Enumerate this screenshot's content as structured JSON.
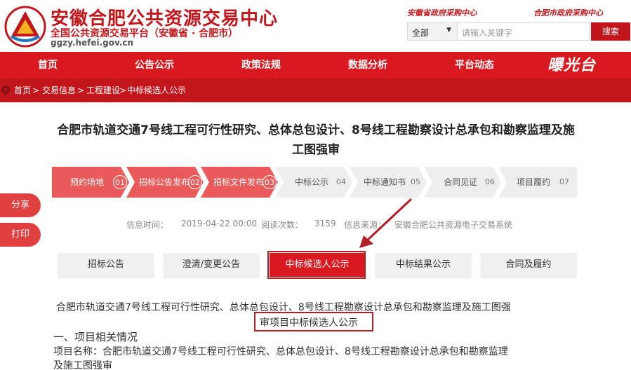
{
  "header": {
    "site_title": "安徽合肥公共资源交易中心",
    "site_subtitle": "全国公共资源交易平台（安徽省 · 合肥市）",
    "site_domain": "ggzy.hefei.gov.cn",
    "gov_link_province": "安徽省政府采购中心",
    "gov_link_city": "合肥市政府采购中心"
  },
  "search": {
    "select_value": "全部",
    "placeholder": "请输入关键字",
    "button_label": "搜索"
  },
  "nav": {
    "items": [
      "首页",
      "公告公示",
      "政策法规",
      "数据分析",
      "平台动态"
    ],
    "brand": "曝光台"
  },
  "breadcrumb": {
    "items": [
      "首页",
      "交易信息",
      "工程建设",
      "中标候选人公示"
    ],
    "separator": " > "
  },
  "article": {
    "title": "合肥市轨道交通7号线工程可行性研究、总体总包设计、8号线工程勘察设计总承包和勘察监理及施工图强审"
  },
  "steps": [
    {
      "label": "预约场地",
      "num": "01",
      "done": true
    },
    {
      "label": "招标公告发布",
      "num": "02",
      "done": true
    },
    {
      "label": "招标文件发布",
      "num": "03",
      "done": true
    },
    {
      "label": "中标公示",
      "num": "04",
      "done": false
    },
    {
      "label": "中标通知书",
      "num": "05",
      "done": false
    },
    {
      "label": "合同见证",
      "num": "06",
      "done": false
    },
    {
      "label": "项目履约",
      "num": "07",
      "done": false
    }
  ],
  "info": {
    "time_label": "信息时间：",
    "time_value": "2019-04-22 00:00",
    "views_label": "阅读次数：",
    "views_value": "3159",
    "source_label": "信息来源：",
    "source_value": "安徽合肥公共资源电子交易系统"
  },
  "side": {
    "share": "分享",
    "print": "打印"
  },
  "tabs": [
    {
      "label": "招标公告",
      "active": false
    },
    {
      "label": "澄清/变更公告",
      "active": false
    },
    {
      "label": "中标候选人公示",
      "active": true
    },
    {
      "label": "中标结果公示",
      "active": false
    },
    {
      "label": "合同及履约",
      "active": false
    }
  ],
  "body": {
    "heading_line1": "合肥市轨道交通7号线工程可行性研究、总体总包设计、8号线工程勘察设计总承包和勘察监理及施工图强",
    "heading_line2": "审项目中标候选人公示",
    "section_title": "一、项目相关情况",
    "project_line1": "项目名称：合肥市轨道交通7号线工程可行性研究、总体总包设计、8号线工程勘察设计总承包和勘察监理",
    "project_line2": "及施工图强审"
  },
  "colors": {
    "brand_red": "#d9181f",
    "dark_red": "#c3161c",
    "annotation_red": "#b21f24",
    "step_done": "#ea5a5a",
    "step_pending": "#eeeeee"
  }
}
